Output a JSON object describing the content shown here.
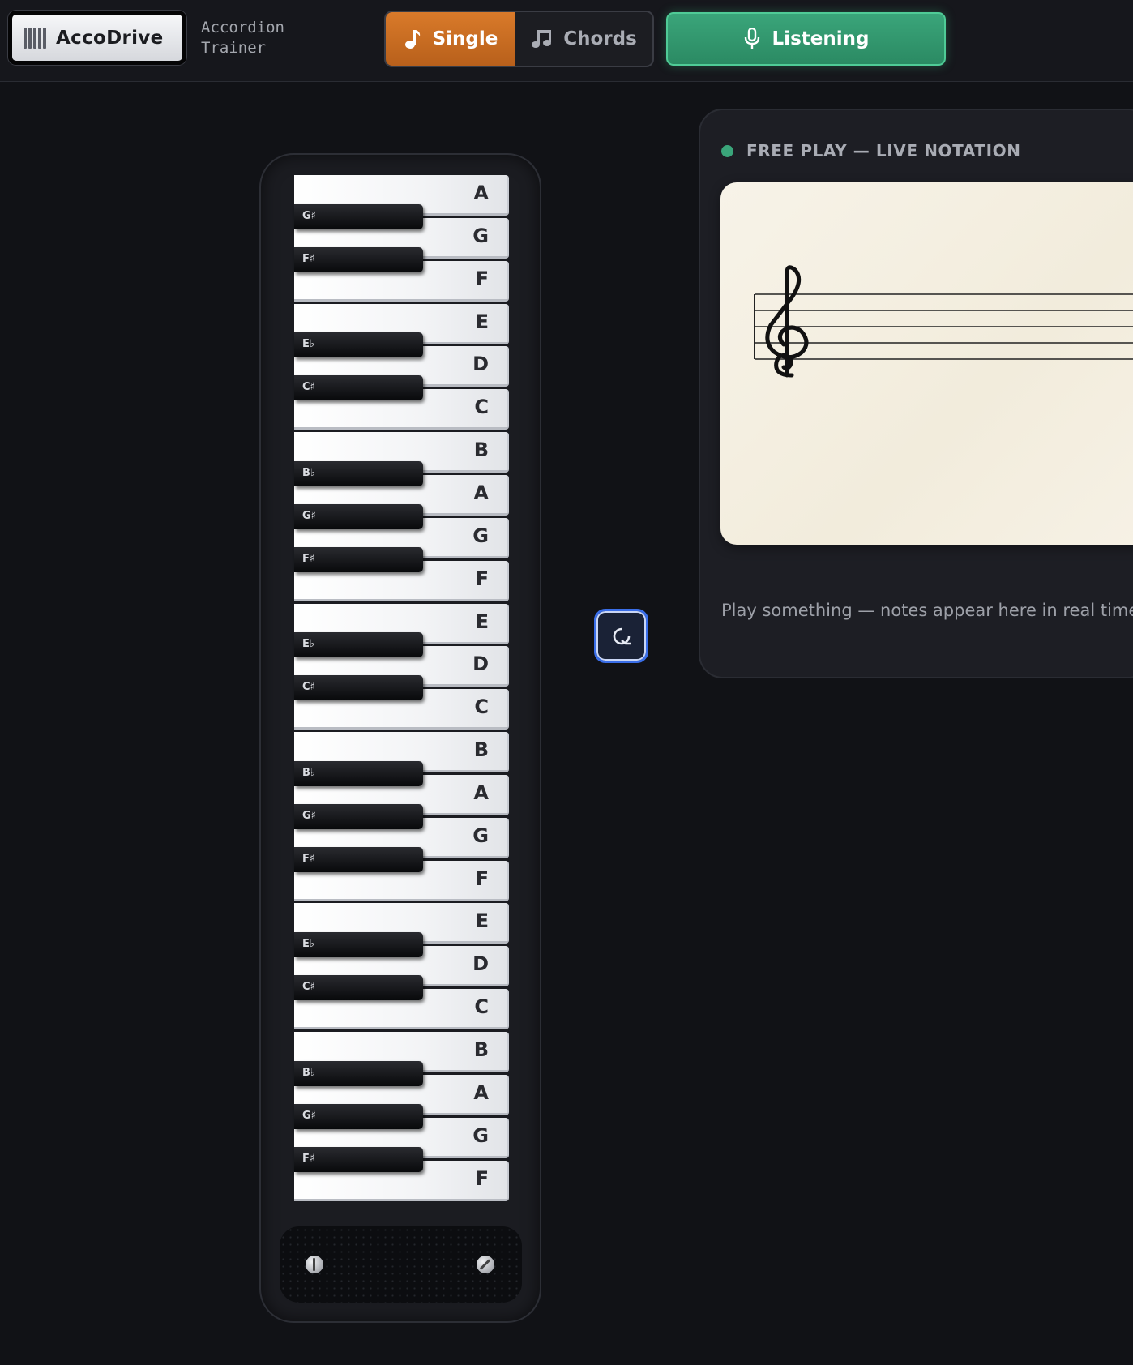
{
  "header": {
    "logo_label": "AccoDrive",
    "subtitle": "Accordion Trainer",
    "mode_single": "Single",
    "mode_chords": "Chords",
    "listen_label": "Listening"
  },
  "keyboard": {
    "white_keys": [
      "A",
      "G",
      "F",
      "E",
      "D",
      "C",
      "B",
      "A",
      "G",
      "F",
      "E",
      "D",
      "C",
      "B",
      "A",
      "G",
      "F",
      "E",
      "D",
      "C",
      "B",
      "A",
      "G",
      "F"
    ],
    "black_keys": [
      "G♯",
      "F♯",
      "E♭",
      "C♯",
      "B♭",
      "G♯",
      "F♯",
      "E♭",
      "C♯",
      "B♭",
      "G♯",
      "F♯",
      "E♭",
      "C♯",
      "B♭",
      "G♯",
      "F♯"
    ]
  },
  "notation": {
    "title": "FREE PLAY — LIVE NOTATION",
    "message": "Play something — notes appear here in real time"
  },
  "colors": {
    "accent_orange": "#c86d22",
    "accent_green": "#34996f",
    "focus_blue": "#3a6ee8"
  },
  "icons": {
    "logo": "accordion-icon",
    "single": "music-note-icon",
    "chords": "chord-notes-icon",
    "listen": "microphone-icon",
    "loop": "loop-icon"
  }
}
